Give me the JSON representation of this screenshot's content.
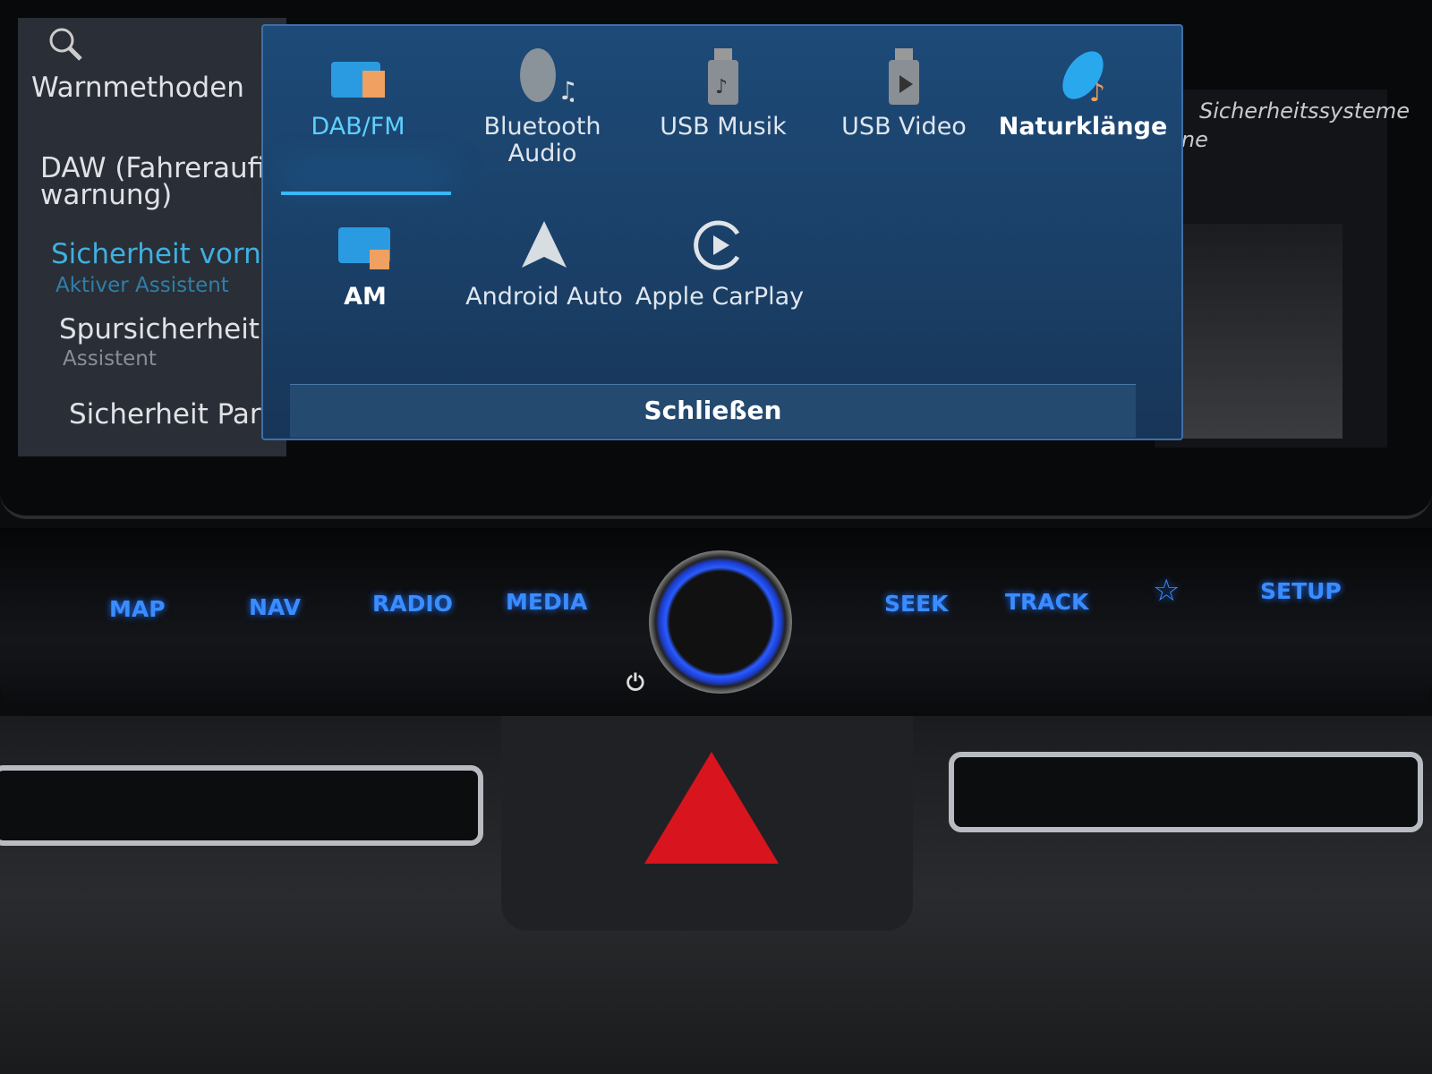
{
  "left_menu": {
    "search_icon": "search-icon",
    "items": [
      {
        "label": "Warnmethoden"
      },
      {
        "label": "DAW (Fahreraufi",
        "label2": "warnung)"
      },
      {
        "label": "Sicherheit vorne",
        "sub": "Aktiver Assistent",
        "active": true
      },
      {
        "label": "Spursicherheit",
        "sub": "Assistent"
      },
      {
        "label": "Sicherheit Parke"
      }
    ]
  },
  "right_panel": {
    "title": "Sicherheitssysteme",
    "line2": "rne"
  },
  "media_popup": {
    "sources": [
      {
        "label": "DAB/FM",
        "icon": "radio-dab-fm-icon",
        "selected": true
      },
      {
        "label": "Bluetooth Audio",
        "icon": "bluetooth-audio-icon"
      },
      {
        "label": "USB Musik",
        "icon": "usb-music-icon"
      },
      {
        "label": "USB Video",
        "icon": "usb-video-icon"
      },
      {
        "label": "Naturklänge",
        "icon": "nature-sounds-icon"
      },
      {
        "label": "AM",
        "icon": "radio-am-icon"
      },
      {
        "label": "Android Auto",
        "icon": "android-auto-icon"
      },
      {
        "label": "Apple CarPlay",
        "icon": "apple-carplay-icon"
      }
    ],
    "close_label": "Schließen"
  },
  "hardware_buttons": {
    "map": "MAP",
    "nav": "NAV",
    "radio": "RADIO",
    "media": "MEDIA",
    "seek": "SEEK",
    "track": "TRACK",
    "setup": "SETUP",
    "favorite_icon": "star-icon",
    "power_icon": "power-icon"
  },
  "colors": {
    "accent": "#39b6ff",
    "button_glow": "#3a8dff",
    "hazard": "#d8141e",
    "popup_bg": "#1d4a78"
  }
}
